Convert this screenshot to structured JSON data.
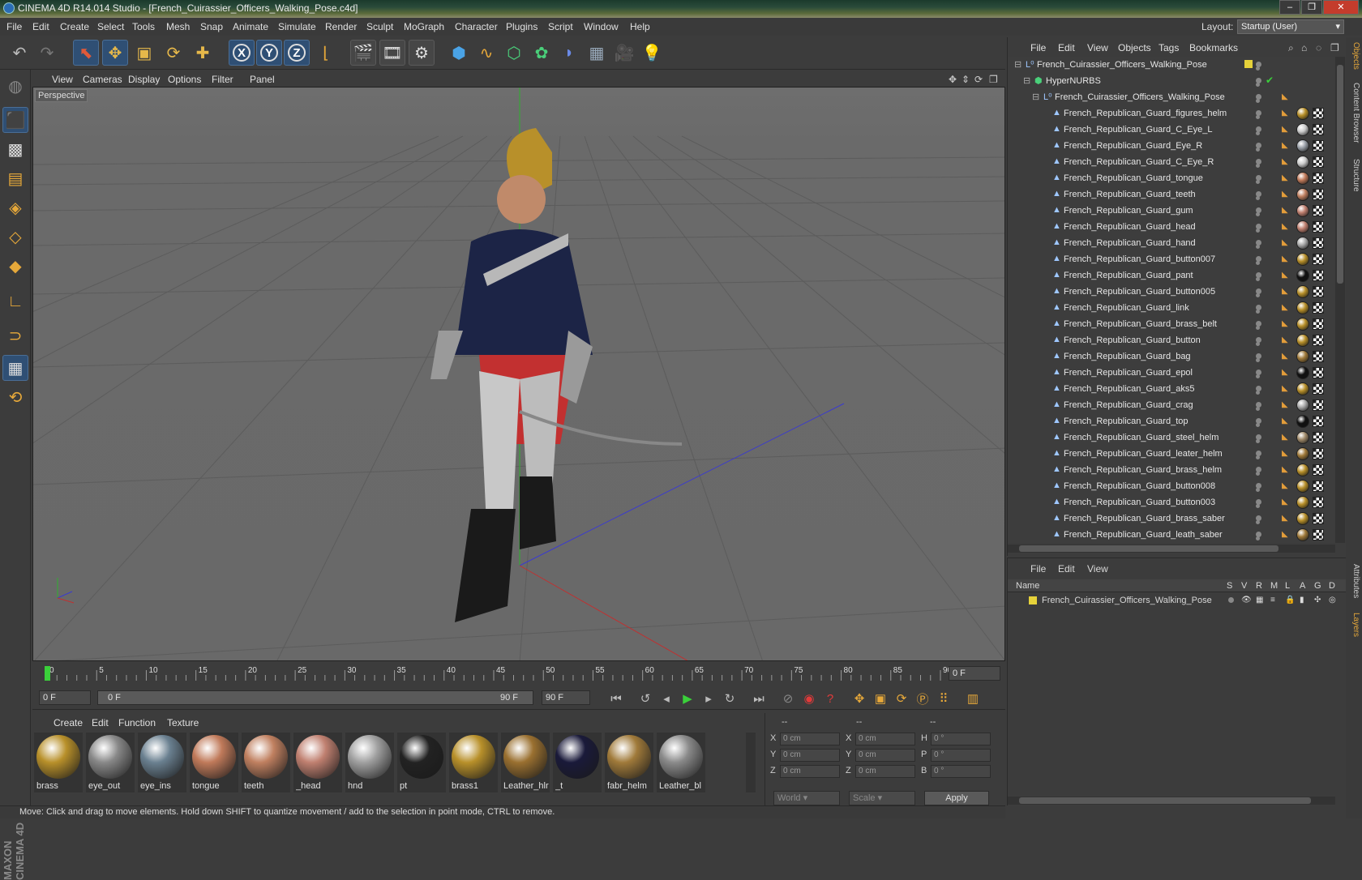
{
  "titlebar": {
    "title": "CINEMA 4D R14.014 Studio - [French_Cuirassier_Officers_Walking_Pose.c4d]"
  },
  "menubar": [
    "File",
    "Edit",
    "Create",
    "Select",
    "Tools",
    "Mesh",
    "Snap",
    "Animate",
    "Simulate",
    "Render",
    "Sculpt",
    "MoGraph",
    "Character",
    "Plugins",
    "Script",
    "Window",
    "Help"
  ],
  "layout": {
    "label": "Layout:",
    "value": "Startup (User)"
  },
  "viewport": {
    "menu": [
      "View",
      "Cameras",
      "Display",
      "Options",
      "Filter",
      "Panel"
    ],
    "label": "Perspective"
  },
  "timeline": {
    "ticks": [
      "0",
      "5",
      "10",
      "15",
      "20",
      "25",
      "30",
      "35",
      "40",
      "45",
      "50",
      "55",
      "60",
      "65",
      "70",
      "75",
      "80",
      "85",
      "90"
    ],
    "current_frame": "0 F"
  },
  "animation": {
    "start": "0 F",
    "range_start": "0 F",
    "range_end": "90 F",
    "end": "90 F"
  },
  "materials": {
    "menu": [
      "Create",
      "Edit",
      "Function",
      "Texture"
    ],
    "items": [
      {
        "label": "brass",
        "color": "#b8902a"
      },
      {
        "label": "eye_out",
        "color": "#888888"
      },
      {
        "label": "eye_ins",
        "color": "#6a8090"
      },
      {
        "label": "tongue",
        "color": "#c07a5a"
      },
      {
        "label": "teeth",
        "color": "#c08060"
      },
      {
        "label": "_head",
        "color": "#c08070"
      },
      {
        "label": "hnd",
        "color": "#a0a0a0"
      },
      {
        "label": "pt",
        "color": "#222222"
      },
      {
        "label": "brass1",
        "color": "#b8902a"
      },
      {
        "label": "Leather_hlr",
        "color": "#9a7030"
      },
      {
        "label": "_t",
        "color": "#1a1a3a"
      },
      {
        "label": "fabr_helm",
        "color": "#a07a3a"
      },
      {
        "label": "Leather_bl",
        "color": "#8a8a8a"
      }
    ]
  },
  "coordinates": {
    "header": [
      "--",
      "--",
      "--"
    ],
    "rows": [
      {
        "l1": "X",
        "v1": "0 cm",
        "l2": "X",
        "v2": "0 cm",
        "l3": "H",
        "v3": "0 °"
      },
      {
        "l1": "Y",
        "v1": "0 cm",
        "l2": "Y",
        "v2": "0 cm",
        "l3": "P",
        "v3": "0 °"
      },
      {
        "l1": "Z",
        "v1": "0 cm",
        "l2": "Z",
        "v2": "0 cm",
        "l3": "B",
        "v3": "0 °"
      }
    ],
    "mode1": "World",
    "mode2": "Scale",
    "apply": "Apply"
  },
  "status": "Move: Click and drag to move elements. Hold down SHIFT to quantize movement / add to the selection in point mode, CTRL to remove.",
  "objects": {
    "menu": [
      "File",
      "Edit",
      "View",
      "Objects",
      "Tags",
      "Bookmarks"
    ],
    "rows": [
      {
        "name": "French_Cuirassier_Officers_Walking_Pose",
        "indent": 0
      },
      {
        "name": "HyperNURBS",
        "indent": 1
      },
      {
        "name": "French_Cuirassier_Officers_Walking_Pose",
        "indent": 2
      },
      {
        "name": "French_Republican_Guard_figures_helm",
        "indent": 3
      },
      {
        "name": "French_Republican_Guard_C_Eye_L",
        "indent": 3
      },
      {
        "name": "French_Republican_Guard_Eye_R",
        "indent": 3
      },
      {
        "name": "French_Republican_Guard_C_Eye_R",
        "indent": 3
      },
      {
        "name": "French_Republican_Guard_tongue",
        "indent": 3
      },
      {
        "name": "French_Republican_Guard_teeth",
        "indent": 3
      },
      {
        "name": "French_Republican_Guard_gum",
        "indent": 3
      },
      {
        "name": "French_Republican_Guard_head",
        "indent": 3
      },
      {
        "name": "French_Republican_Guard_hand",
        "indent": 3
      },
      {
        "name": "French_Republican_Guard_button007",
        "indent": 3
      },
      {
        "name": "French_Republican_Guard_pant",
        "indent": 3
      },
      {
        "name": "French_Republican_Guard_button005",
        "indent": 3
      },
      {
        "name": "French_Republican_Guard_link",
        "indent": 3
      },
      {
        "name": "French_Republican_Guard_brass_belt",
        "indent": 3
      },
      {
        "name": "French_Republican_Guard_button",
        "indent": 3
      },
      {
        "name": "French_Republican_Guard_bag",
        "indent": 3
      },
      {
        "name": "French_Republican_Guard_epol",
        "indent": 3
      },
      {
        "name": "French_Republican_Guard_aks5",
        "indent": 3
      },
      {
        "name": "French_Republican_Guard_crag",
        "indent": 3
      },
      {
        "name": "French_Republican_Guard_top",
        "indent": 3
      },
      {
        "name": "French_Republican_Guard_steel_helm",
        "indent": 3
      },
      {
        "name": "French_Republican_Guard_leater_helm",
        "indent": 3
      },
      {
        "name": "French_Republican_Guard_brass_helm",
        "indent": 3
      },
      {
        "name": "French_Republican_Guard_button008",
        "indent": 3
      },
      {
        "name": "French_Republican_Guard_button003",
        "indent": 3
      },
      {
        "name": "French_Republican_Guard_brass_saber",
        "indent": 3
      },
      {
        "name": "French_Republican_Guard_leath_saber",
        "indent": 3
      }
    ]
  },
  "layers": {
    "menu": [
      "File",
      "Edit",
      "View"
    ],
    "columns": [
      "Name",
      "S",
      "V",
      "R",
      "M",
      "L",
      "A",
      "G",
      "D"
    ],
    "rows": [
      {
        "name": "French_Cuirassier_Officers_Walking_Pose",
        "color": "#e6d23a"
      }
    ]
  },
  "sidetabs": [
    "Objects",
    "Content Browser",
    "Structure",
    "Attributes",
    "Layers"
  ]
}
